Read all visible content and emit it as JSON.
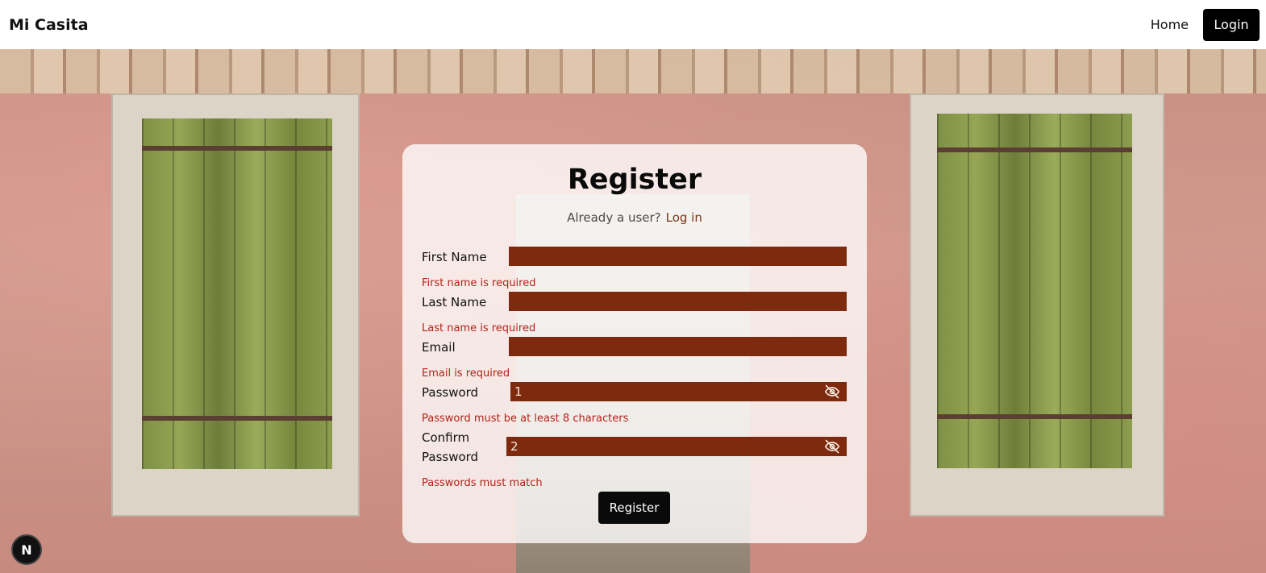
{
  "header": {
    "brand": "Mi Casita",
    "nav": {
      "home": "Home",
      "login": "Login"
    }
  },
  "form": {
    "title": "Register",
    "already_text": "Already a user?",
    "login_link": "Log in",
    "fields": {
      "first_name": {
        "label": "First Name",
        "value": "",
        "error": "First name is required"
      },
      "last_name": {
        "label": "Last Name",
        "value": "",
        "error": "Last name is required"
      },
      "email": {
        "label": "Email",
        "value": "",
        "error": "Email is required"
      },
      "password": {
        "label": "Password",
        "value": "1",
        "error": "Password must be at least 8 characters"
      },
      "confirm_password": {
        "label_line1": "Confirm",
        "label_line2": "Password",
        "value": "2",
        "error": "Passwords must match"
      }
    },
    "submit": "Register"
  },
  "badge": {
    "letter": "N"
  },
  "colors": {
    "field_bg": "#7e2a0e",
    "error": "#b42318",
    "button": "#0a0a0a"
  },
  "icons": {
    "password_toggle": "eye-off-icon"
  }
}
